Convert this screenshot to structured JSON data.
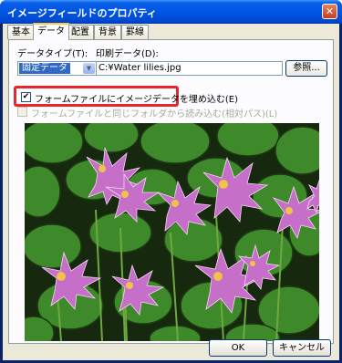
{
  "window": {
    "title": "イメージフィールドのプロパティ",
    "close_glyph": "✕"
  },
  "tabs": [
    {
      "label": "基本"
    },
    {
      "label": "データ",
      "active": true
    },
    {
      "label": "配置"
    },
    {
      "label": "背景"
    },
    {
      "label": "罫線"
    }
  ],
  "data_type": {
    "label": "データタイプ(T):",
    "value": "固定データ",
    "arrow": "▼"
  },
  "print_data": {
    "label": "印刷データ(D):",
    "value": "C:¥Water lilies.jpg",
    "browse_label": "参照..."
  },
  "embed_checkbox": {
    "label": "フォームファイルにイメージデータを埋め込む(E)",
    "checked": true,
    "mark": "✔"
  },
  "same_folder_checkbox": {
    "label": "フォームファイルと同じフォルダから読み込む(相対パス)(L)",
    "checked": false,
    "disabled": true
  },
  "preview": {
    "icon": "water-lilies-photo"
  },
  "buttons": {
    "ok": "OK",
    "cancel": "キャンセル"
  },
  "colors": {
    "title_bar": "#0055e5",
    "highlight": "#e8262b",
    "selection": "#316ac5",
    "dialog_bg": "#ece9d8"
  }
}
